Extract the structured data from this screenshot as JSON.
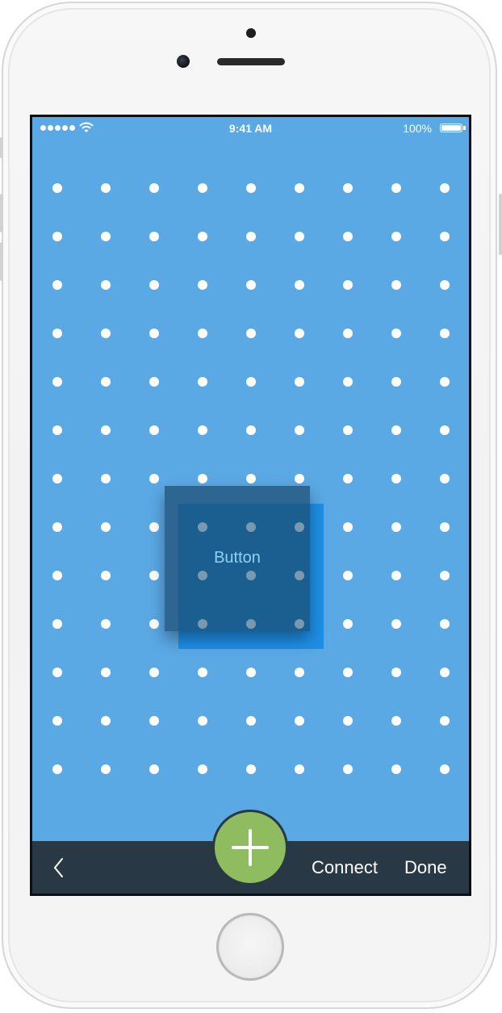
{
  "status_bar": {
    "time": "9:41 AM",
    "battery_percent": "100%",
    "signal_bars": 5
  },
  "canvas": {
    "background_color": "#5aa8e4",
    "dot_color": "#ffffff",
    "dot_columns": 9,
    "dot_rows": 13
  },
  "widget": {
    "label": "Button"
  },
  "toolbar": {
    "back_icon": "chevron-left-icon",
    "add_icon": "plus-icon",
    "connect_label": "Connect",
    "done_label": "Done",
    "add_button_color": "#8ebc5e",
    "background_color": "#283845"
  }
}
